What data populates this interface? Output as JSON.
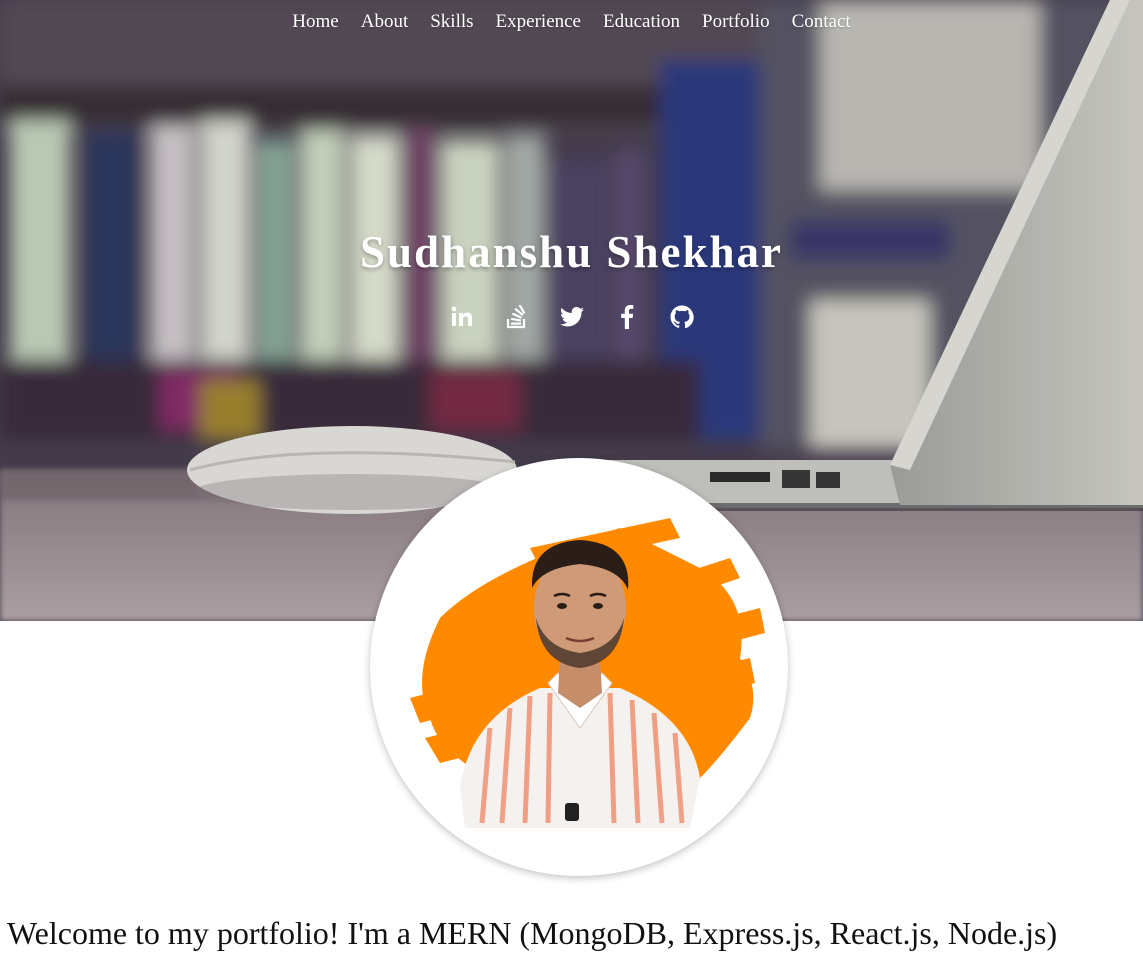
{
  "nav": {
    "items": [
      {
        "label": "Home"
      },
      {
        "label": "About"
      },
      {
        "label": "Skills"
      },
      {
        "label": "Experience"
      },
      {
        "label": "Education"
      },
      {
        "label": "Portfolio"
      },
      {
        "label": "Contact"
      }
    ]
  },
  "hero": {
    "name": "Sudhanshu Shekhar",
    "socials": [
      {
        "icon": "linkedin-icon"
      },
      {
        "icon": "stackoverflow-icon"
      },
      {
        "icon": "twitter-icon"
      },
      {
        "icon": "facebook-icon"
      },
      {
        "icon": "github-icon"
      }
    ]
  },
  "profile": {
    "accent_color": "#ff8a00"
  },
  "intro": {
    "text": "Welcome to my portfolio! I'm a MERN (MongoDB, Express.js, React.js, Node.js)"
  }
}
